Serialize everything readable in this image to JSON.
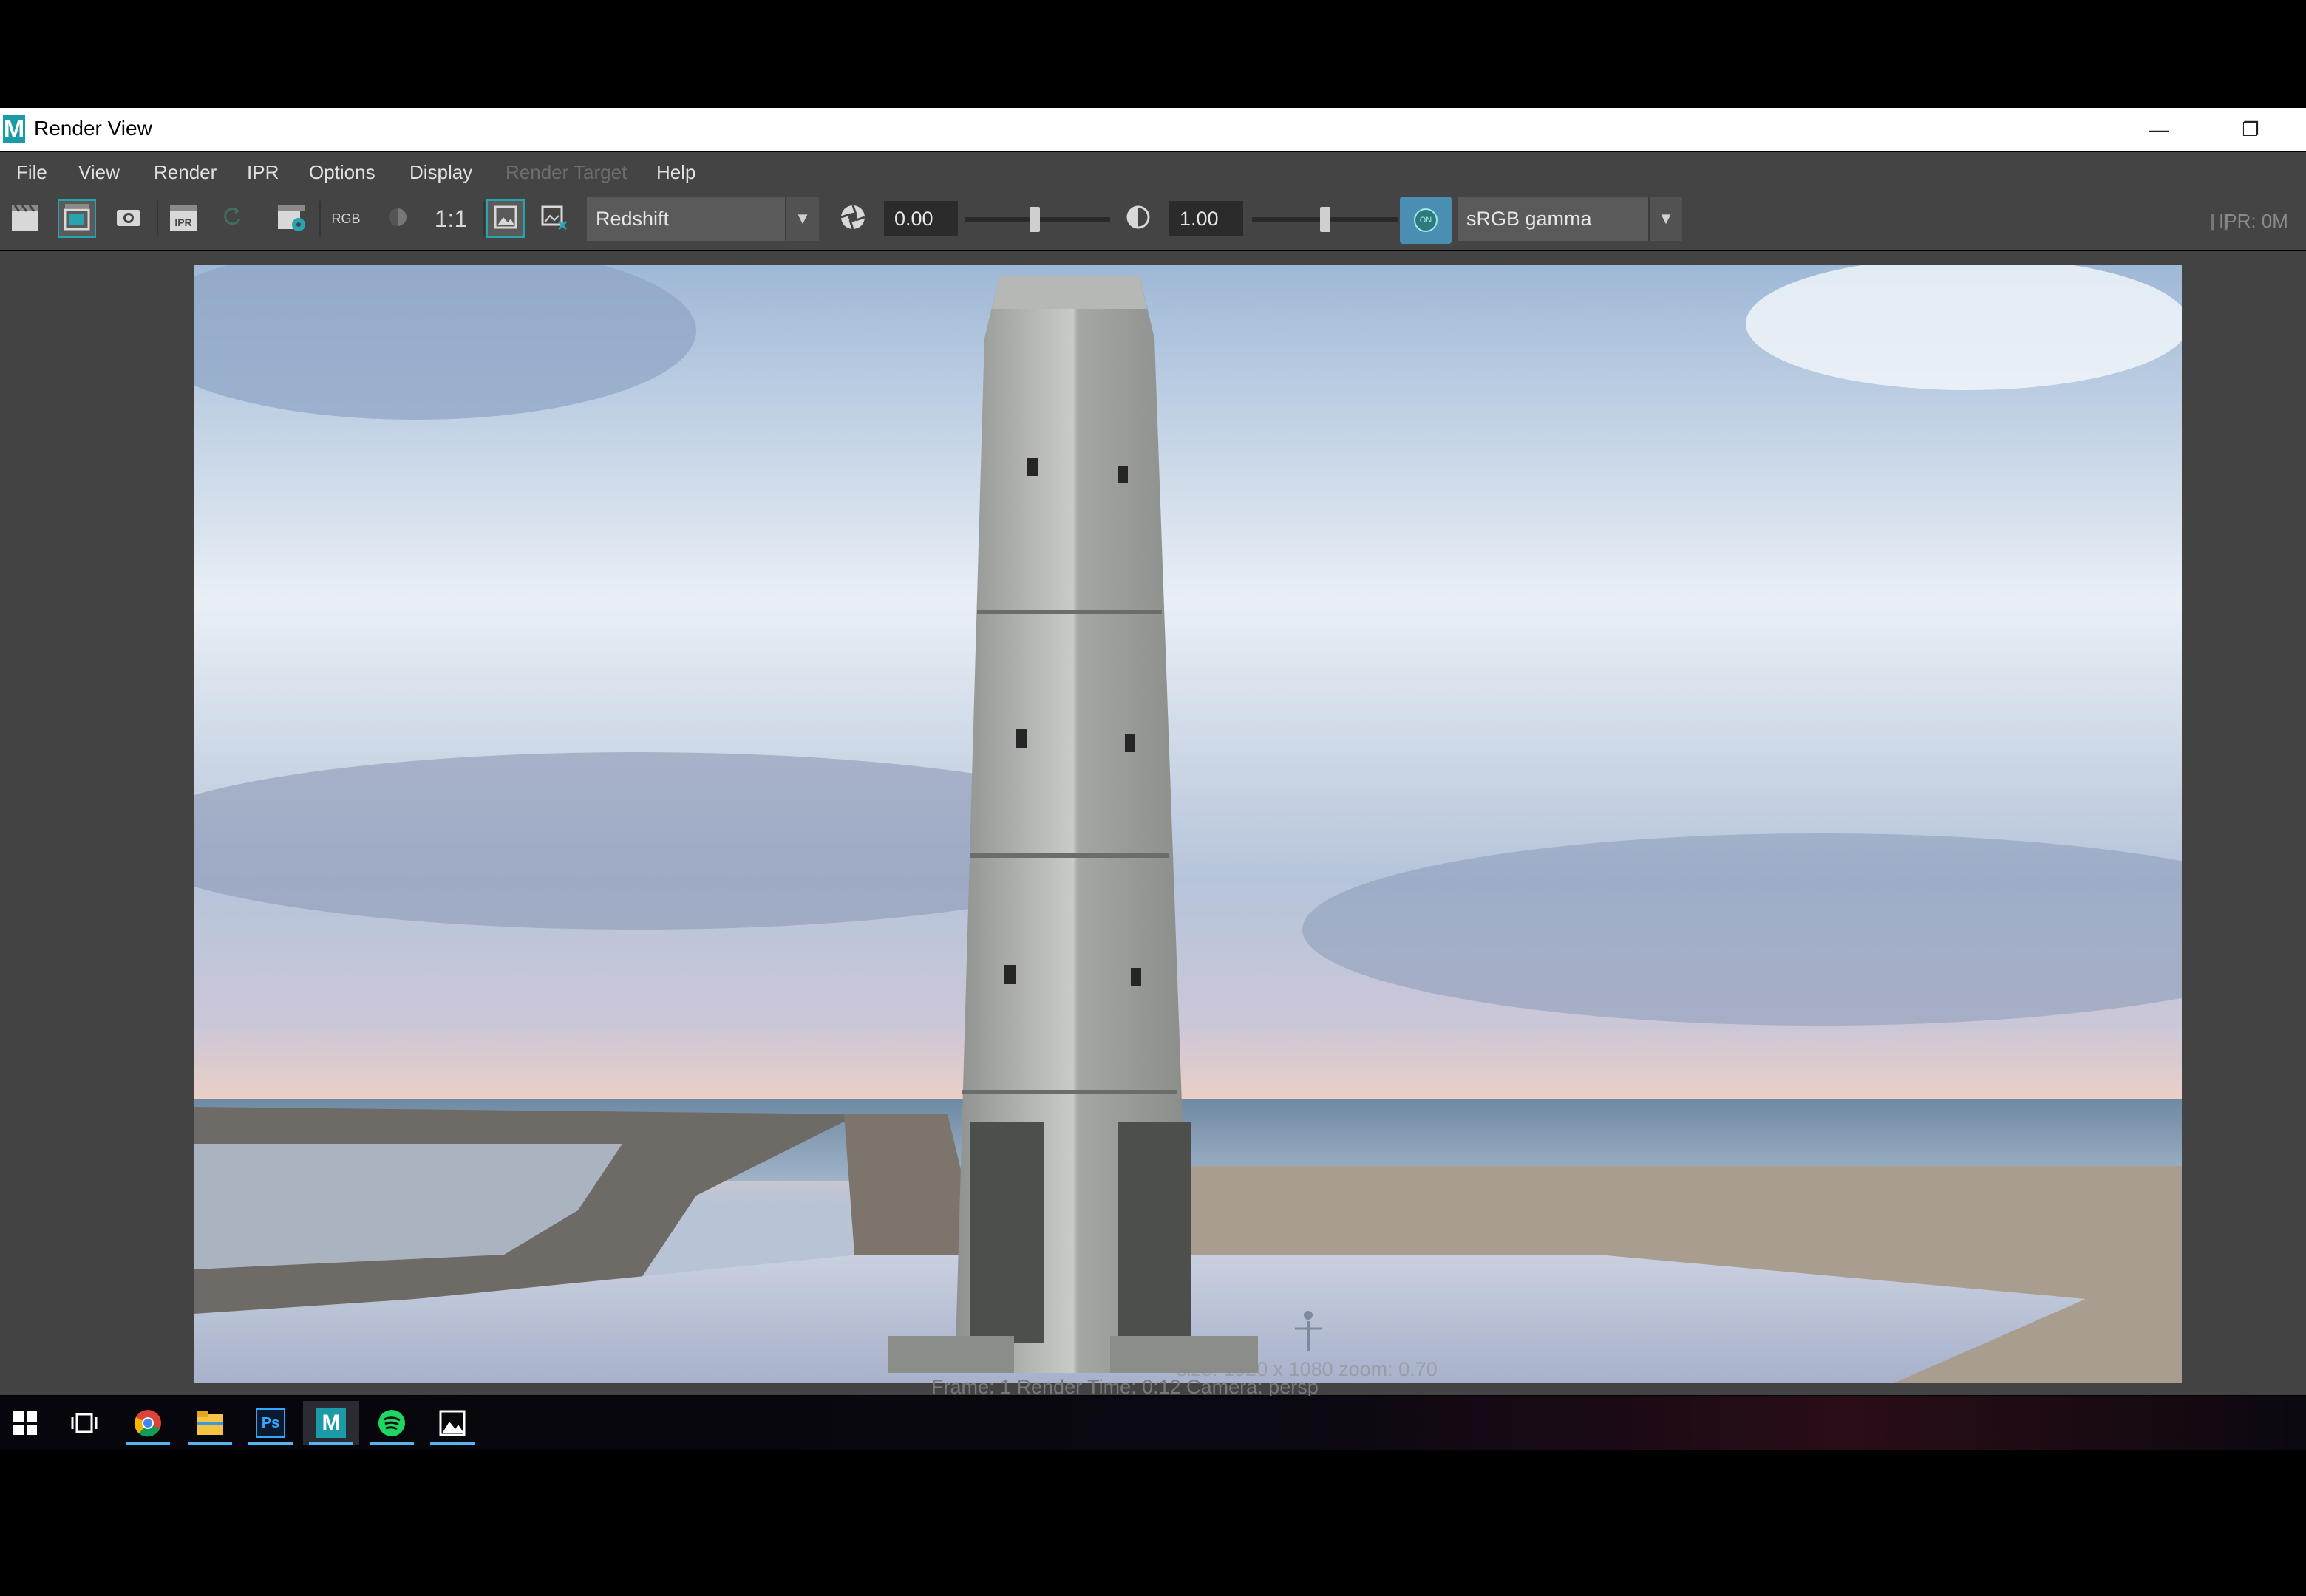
{
  "window": {
    "title": "Render View",
    "app_logo": "M",
    "minimize_icon": "minimize-icon",
    "restore_icon": "restore-icon"
  },
  "menu": [
    "File",
    "View",
    "Render",
    "IPR",
    "Options",
    "Display",
    "Render Target",
    "Help"
  ],
  "toolbar": {
    "rgb_label": "RGB",
    "ratio_label": "1:1",
    "ipr_label": "IPR",
    "renderer": "Redshift",
    "exposure": "0.00",
    "gamma": "1.00",
    "exposure_slider_fraction": 0.48,
    "gamma_slider_fraction": 0.5,
    "color_mgmt_toggle": "ON",
    "color_space": "sRGB gamma",
    "ipr_status": "IPR: 0M"
  },
  "render": {
    "status_line": "size: 1920 x 1080  zoom: 0.70",
    "frame_line": "Frame: 1     Render Time: 0:12     Camera: persp"
  },
  "taskbar": {
    "icons": [
      "windows-start-icon",
      "task-view-icon",
      "chrome-icon",
      "file-explorer-icon",
      "photoshop-icon",
      "maya-icon",
      "spotify-icon",
      "photos-icon"
    ],
    "ps_label": "Ps",
    "maya_label": "M"
  },
  "colors": {
    "accent": "#2aa3b0",
    "toolbar_bg": "#444444",
    "taskbar_underline": "#56b4f0"
  }
}
